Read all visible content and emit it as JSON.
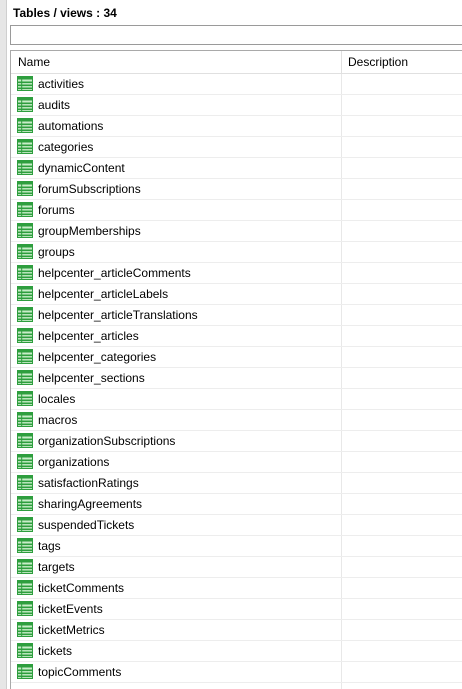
{
  "title": "Tables / views : 34",
  "filter": {
    "value": ""
  },
  "columns": {
    "name": "Name",
    "description": "Description"
  },
  "icon": "table-icon",
  "colors": {
    "icon_green": "#2e9e3e",
    "icon_light": "#c8ecc8"
  },
  "tables": [
    {
      "name": "activities",
      "description": ""
    },
    {
      "name": "audits",
      "description": ""
    },
    {
      "name": "automations",
      "description": ""
    },
    {
      "name": "categories",
      "description": ""
    },
    {
      "name": "dynamicContent",
      "description": ""
    },
    {
      "name": "forumSubscriptions",
      "description": ""
    },
    {
      "name": "forums",
      "description": ""
    },
    {
      "name": "groupMemberships",
      "description": ""
    },
    {
      "name": "groups",
      "description": ""
    },
    {
      "name": "helpcenter_articleComments",
      "description": ""
    },
    {
      "name": "helpcenter_articleLabels",
      "description": ""
    },
    {
      "name": "helpcenter_articleTranslations",
      "description": ""
    },
    {
      "name": "helpcenter_articles",
      "description": ""
    },
    {
      "name": "helpcenter_categories",
      "description": ""
    },
    {
      "name": "helpcenter_sections",
      "description": ""
    },
    {
      "name": "locales",
      "description": ""
    },
    {
      "name": "macros",
      "description": ""
    },
    {
      "name": "organizationSubscriptions",
      "description": ""
    },
    {
      "name": "organizations",
      "description": ""
    },
    {
      "name": "satisfactionRatings",
      "description": ""
    },
    {
      "name": "sharingAgreements",
      "description": ""
    },
    {
      "name": "suspendedTickets",
      "description": ""
    },
    {
      "name": "tags",
      "description": ""
    },
    {
      "name": "targets",
      "description": ""
    },
    {
      "name": "ticketComments",
      "description": ""
    },
    {
      "name": "ticketEvents",
      "description": ""
    },
    {
      "name": "ticketMetrics",
      "description": ""
    },
    {
      "name": "tickets",
      "description": ""
    },
    {
      "name": "topicComments",
      "description": ""
    },
    {
      "name": "",
      "description": ""
    }
  ]
}
